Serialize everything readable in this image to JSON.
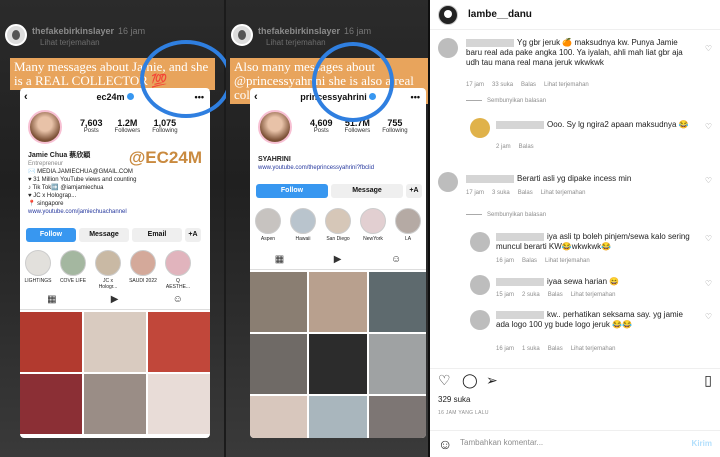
{
  "story_left": {
    "username": "thefakebirkinslayer",
    "time": "16 jam",
    "translate": "Lihat terjemahan",
    "banner": "Many messages about Jamie, and she is a REAL COLLECTOR 💯",
    "profile": {
      "handle": "ec24m",
      "posts": "7,603",
      "posts_label": "Posts",
      "followers": "1.2M",
      "followers_label": "Followers",
      "following": "1,075",
      "following_label": "Following",
      "name": "Jamie Chua 蔡欣穎",
      "category": "Entrepreneur",
      "bio1": "✉️ MEDIA.JAMIECHUA@GMAIL.COM",
      "bio2": "♥ 31 Million YouTube views and counting",
      "bio3": "♪ Tik Tok➡️ @iamjamiechua",
      "bio4": "♥ JC x Holograp...",
      "bio5": "📍 singapore",
      "link": "www.youtube.com/jamiechuachannel",
      "watermark": "@EC24M",
      "follow": "Follow",
      "message": "Message",
      "email": "Email",
      "add": "+A",
      "highlights": [
        "LIGHTINGS",
        "COVE LIFE",
        "JC x Hologr...",
        "SAUDI 2022",
        "Q AESTHE..."
      ]
    }
  },
  "story_right": {
    "username": "thefakebirkinslayer",
    "time": "16 jam",
    "translate": "Lihat terjemahan",
    "banner": "Also many messages about @princessyahrini she is also a real collector 😊",
    "profile": {
      "handle": "princessyahrini",
      "posts": "4,609",
      "posts_label": "Posts",
      "followers": "51.7M",
      "followers_label": "Followers",
      "following": "755",
      "following_label": "Following",
      "name": "SYAHRINI",
      "link": "www.youtube.com/theprincessyahrini?fbclid",
      "follow": "Follow",
      "message": "Message",
      "add": "+A",
      "highlights": [
        "Aspen",
        "Hawaii",
        "San Diego",
        "NewYork",
        "LA"
      ]
    }
  },
  "post": {
    "username": "lambe__danu",
    "more": "⋮",
    "comments": [
      {
        "text": "Yg gbr jeruk 🍊 maksudnya kw. Punya Jamie baru real ada pake angka 100. Ya iyalah, ahli mah liat gbr aja udh tau mana real mana jeruk wkwkwk",
        "time": "17 jam",
        "likes": "33 suka",
        "reply": "Balas",
        "translate": "Lihat terjemahan",
        "hide": "Sembunyikan balasan"
      },
      {
        "text": "Ooo. Sy lg ngira2 apaan maksudnya 😂",
        "time": "2 jam",
        "reply": "Balas"
      },
      {
        "text": "Berarti asli yg dipake incess min",
        "time": "17 jam",
        "likes": "3 suka",
        "reply": "Balas",
        "translate": "Lihat terjemahan",
        "hide": "Sembunyikan balasan"
      },
      {
        "text": "iya asli tp boleh pinjem/sewa kalo sering muncul berarti KW😂wkwkwk😂",
        "time": "16 jam",
        "reply": "Balas",
        "translate": "Lihat terjemahan"
      },
      {
        "text": "iyaa sewa harian 😄",
        "time": "15 jam",
        "likes": "2 suka",
        "reply": "Balas",
        "translate": "Lihat terjemahan"
      },
      {
        "text": "kw.. perhatikan seksama say. yg jamie ada logo 100 yg bude logo jeruk 😂😂",
        "time": "16 jam",
        "likes": "1 suka",
        "reply": "Balas",
        "translate": "Lihat terjemahan"
      }
    ],
    "likes": "329 suka",
    "when": "16 JAM YANG LALU",
    "add_comment_placeholder": "Tambahkan komentar...",
    "send": "Kirim"
  },
  "colors": {
    "banner": "#e8a45c",
    "circle": "#2f7fe0",
    "ig_blue": "#3897f0",
    "muted": "#8e8e8e"
  }
}
